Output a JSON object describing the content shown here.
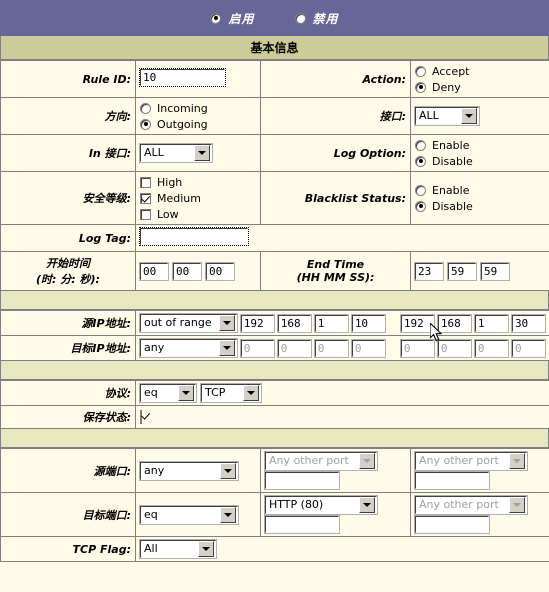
{
  "banner": {
    "enable_label": "启用",
    "enable_selected": true,
    "disable_label": "禁用",
    "disable_selected": false,
    "bg_color": "#666699"
  },
  "section_basic": {
    "title": "基本信息",
    "bg_color": "#cccc99"
  },
  "rows": {
    "rule_id": {
      "label": "Rule ID:",
      "value": "10"
    },
    "action": {
      "label": "Action:",
      "options": [
        {
          "label": "Accept",
          "selected": false
        },
        {
          "label": "Deny",
          "selected": true
        }
      ]
    },
    "direction": {
      "label": "方向:",
      "options": [
        {
          "label": "Incoming",
          "selected": false
        },
        {
          "label": "Outgoing",
          "selected": true
        }
      ]
    },
    "interface": {
      "label": "接口:",
      "value": "ALL"
    },
    "in_interface": {
      "label": "In 接口:",
      "value": "ALL"
    },
    "log_option": {
      "label": "Log Option:",
      "options": [
        {
          "label": "Enable",
          "selected": false
        },
        {
          "label": "Disable",
          "selected": true
        }
      ]
    },
    "security_level": {
      "label": "安全等级:",
      "options": [
        {
          "label": "High",
          "checked": false
        },
        {
          "label": "Medium",
          "checked": true
        },
        {
          "label": "Low",
          "checked": false
        }
      ]
    },
    "blacklist_status": {
      "label": "Blacklist Status:",
      "options": [
        {
          "label": "Enable",
          "selected": false
        },
        {
          "label": "Disable",
          "selected": true
        }
      ]
    },
    "log_tag": {
      "label": "Log Tag:",
      "value": ""
    },
    "start_time": {
      "label_line1": "开始时间",
      "label_line2": "(时: 分: 秒):",
      "hh": "00",
      "mm": "00",
      "ss": "00"
    },
    "end_time": {
      "label_line1": "End Time",
      "label_line2": "(HH MM SS):",
      "hh": "23",
      "mm": "59",
      "ss": "59"
    },
    "source_ip": {
      "label": "源IP地址:",
      "mode": "out of range",
      "start": [
        "192",
        "168",
        "1",
        "10"
      ],
      "end": [
        "192",
        "168",
        "1",
        "30"
      ]
    },
    "dest_ip": {
      "label": "目标IP地址:",
      "mode": "any",
      "start": [
        "0",
        "0",
        "0",
        "0"
      ],
      "end": [
        "0",
        "0",
        "0",
        "0"
      ]
    },
    "protocol": {
      "label": "协议:",
      "operator": "eq",
      "value": "TCP"
    },
    "save_state": {
      "label": "保存状态:",
      "checked": true
    },
    "source_port": {
      "label": "源端口:",
      "operator": "any",
      "port1_select": "Any other port",
      "port1_text": "",
      "port2_select": "Any other port",
      "port2_text": ""
    },
    "dest_port": {
      "label": "目标端口:",
      "operator": "eq",
      "port1_select": "HTTP (80)",
      "port1_text": "",
      "port2_select": "Any other port",
      "port2_text": ""
    },
    "tcp_flag": {
      "label": "TCP Flag:",
      "value": "All"
    }
  }
}
